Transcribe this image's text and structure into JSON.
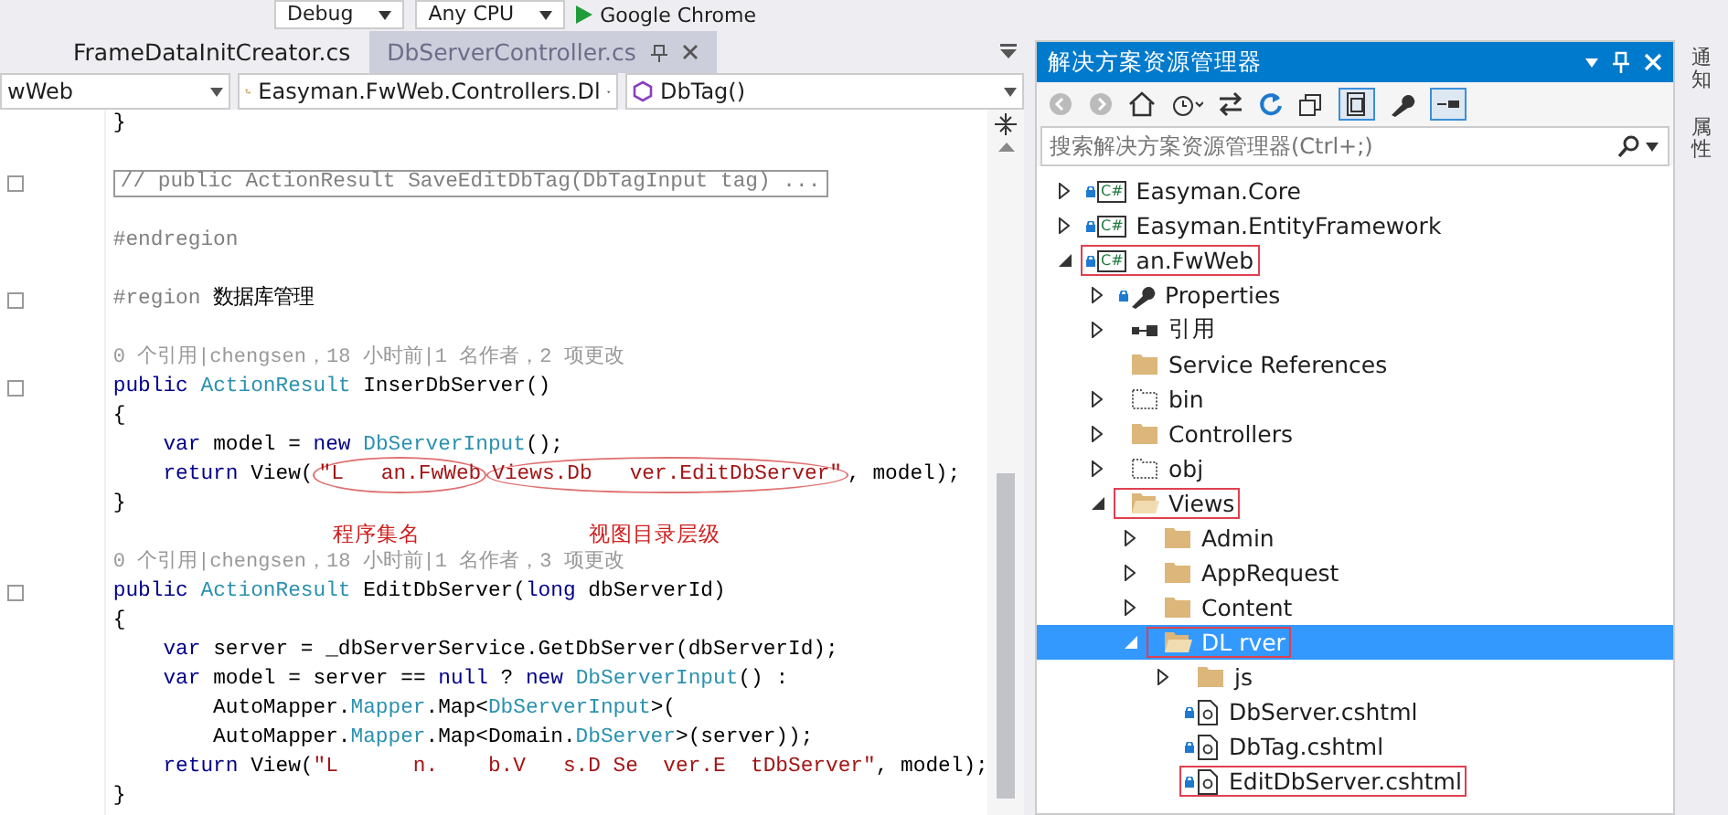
{
  "toolbar": {
    "config": "Debug",
    "platform": "Any CPU",
    "run_target": "Google Chrome"
  },
  "editor": {
    "tabs": [
      {
        "label": "FrameDataInitCreator.cs",
        "selected": false
      },
      {
        "label": "DbServerController.cs",
        "selected": true
      }
    ],
    "nav": {
      "project": "wWeb",
      "type": "Easyman.FwWeb.Controllers.Dl",
      "member": "DbTag()"
    },
    "lines": [
      {
        "kind": "code",
        "fold": false,
        "tokens": [
          {
            "kind": "plain",
            "text": "}"
          }
        ]
      },
      {
        "kind": "blank",
        "fold": false
      },
      {
        "kind": "code",
        "fold": true,
        "tokens": [
          {
            "kind": "collapsed",
            "text": "// public ActionResult SaveEditDbTag(DbTagInput tag) ..."
          }
        ]
      },
      {
        "kind": "blank",
        "fold": false
      },
      {
        "kind": "code",
        "fold": false,
        "tokens": [
          {
            "kind": "preproc",
            "text": "#endregion"
          }
        ]
      },
      {
        "kind": "blank",
        "fold": false
      },
      {
        "kind": "code",
        "fold": true,
        "tokens": [
          {
            "kind": "preproc",
            "text": "#region"
          },
          {
            "kind": "plain",
            "text": " 数据库管理"
          }
        ]
      },
      {
        "kind": "blank",
        "fold": false
      },
      {
        "kind": "lens",
        "fold": false,
        "tokens": [
          {
            "kind": "plain",
            "text": "0 个引用|chengsen，18 小时前|1 名作者，2 项更改"
          }
        ]
      },
      {
        "kind": "code",
        "fold": true,
        "tokens": [
          {
            "kind": "keyword",
            "text": "public "
          },
          {
            "kind": "type",
            "text": "ActionResult"
          },
          {
            "kind": "plain",
            "text": " InserDbServer()"
          }
        ]
      },
      {
        "kind": "code",
        "fold": false,
        "tokens": [
          {
            "kind": "plain",
            "text": "{"
          }
        ]
      },
      {
        "kind": "code",
        "fold": false,
        "tokens": [
          {
            "kind": "keyword",
            "text": "    var"
          },
          {
            "kind": "plain",
            "text": " model = "
          },
          {
            "kind": "keyword",
            "text": "new "
          },
          {
            "kind": "type",
            "text": "DbServerInput"
          },
          {
            "kind": "plain",
            "text": "();"
          }
        ]
      },
      {
        "kind": "code",
        "fold": false,
        "tokens": [
          {
            "kind": "keyword",
            "text": "    return"
          },
          {
            "kind": "plain",
            "text": " View("
          },
          {
            "kind": "string-circled",
            "text": "\"L   an.FwWeb"
          },
          {
            "kind": "string-circled",
            "text": "Views.Db   ver.EditDbServer\""
          },
          {
            "kind": "plain",
            "text": ", model);"
          }
        ]
      },
      {
        "kind": "code",
        "fold": false,
        "tokens": [
          {
            "kind": "plain",
            "text": "}"
          }
        ]
      },
      {
        "kind": "note",
        "fold": false,
        "tokens": [
          {
            "kind": "label",
            "text": "程序集名"
          },
          {
            "kind": "label",
            "text": "视图目录层级"
          }
        ]
      },
      {
        "kind": "lens",
        "fold": false,
        "tokens": [
          {
            "kind": "plain",
            "text": "0 个引用|chengsen，18 小时前|1 名作者，3 项更改"
          }
        ]
      },
      {
        "kind": "code",
        "fold": true,
        "tokens": [
          {
            "kind": "keyword",
            "text": "public "
          },
          {
            "kind": "type",
            "text": "ActionResult"
          },
          {
            "kind": "plain",
            "text": " EditDbServer("
          },
          {
            "kind": "keyword",
            "text": "long"
          },
          {
            "kind": "plain",
            "text": " dbServerId)"
          }
        ]
      },
      {
        "kind": "code",
        "fold": false,
        "tokens": [
          {
            "kind": "plain",
            "text": "{"
          }
        ]
      },
      {
        "kind": "code",
        "fold": false,
        "tokens": [
          {
            "kind": "keyword",
            "text": "    var"
          },
          {
            "kind": "plain",
            "text": " server = _dbServerService.GetDbServer(dbServerId);"
          }
        ]
      },
      {
        "kind": "code",
        "fold": false,
        "tokens": [
          {
            "kind": "keyword",
            "text": "    var"
          },
          {
            "kind": "plain",
            "text": " model = server == "
          },
          {
            "kind": "keyword",
            "text": "null"
          },
          {
            "kind": "plain",
            "text": " ? "
          },
          {
            "kind": "keyword",
            "text": "new "
          },
          {
            "kind": "type",
            "text": "DbServerInput"
          },
          {
            "kind": "plain",
            "text": "() :"
          }
        ]
      },
      {
        "kind": "code",
        "fold": false,
        "tokens": [
          {
            "kind": "plain",
            "text": "        AutoMapper."
          },
          {
            "kind": "type",
            "text": "Mapper"
          },
          {
            "kind": "plain",
            "text": ".Map<"
          },
          {
            "kind": "type",
            "text": "DbServerInput"
          },
          {
            "kind": "plain",
            "text": ">("
          }
        ]
      },
      {
        "kind": "code",
        "fold": false,
        "tokens": [
          {
            "kind": "plain",
            "text": "        AutoMapper."
          },
          {
            "kind": "type",
            "text": "Mapper"
          },
          {
            "kind": "plain",
            "text": ".Map<Domain."
          },
          {
            "kind": "type",
            "text": "DbServer"
          },
          {
            "kind": "plain",
            "text": ">(server));"
          }
        ]
      },
      {
        "kind": "code",
        "fold": false,
        "tokens": [
          {
            "kind": "keyword",
            "text": "    return"
          },
          {
            "kind": "plain",
            "text": " View("
          },
          {
            "kind": "string",
            "text": "\"L      n.    b.V   s.D Se  ver.E  tDbServer\""
          },
          {
            "kind": "plain",
            "text": ", model);"
          }
        ]
      },
      {
        "kind": "code",
        "fold": false,
        "tokens": [
          {
            "kind": "plain",
            "text": "}"
          }
        ]
      }
    ]
  },
  "explorer": {
    "title": "解决方案资源管理器",
    "search": {
      "placeholder": "搜索解决方案资源管理器(Ctrl+;)"
    },
    "tree": [
      {
        "label": "Easyman.Core",
        "kind": "project",
        "badge": "C#",
        "expandable": true,
        "expanded": false,
        "locked": true,
        "selected": false,
        "marked": false
      },
      {
        "label": "Easyman.EntityFramework",
        "kind": "project",
        "badge": "C#",
        "expandable": true,
        "expanded": false,
        "locked": true,
        "selected": false,
        "marked": false
      },
      {
        "label": "an.FwWeb",
        "kind": "project",
        "badge": "C#",
        "expandable": true,
        "expanded": true,
        "locked": true,
        "selected": false,
        "marked": true,
        "children": [
          {
            "label": "Properties",
            "kind": "properties",
            "expandable": true,
            "expanded": false,
            "locked": true,
            "selected": false,
            "marked": false
          },
          {
            "label": "引用",
            "kind": "references",
            "expandable": true,
            "expanded": false,
            "locked": false,
            "selected": false,
            "marked": false
          },
          {
            "label": "Service References",
            "kind": "folder",
            "expandable": false,
            "expanded": false,
            "locked": false,
            "selected": false,
            "marked": false
          },
          {
            "label": "bin",
            "kind": "hidden-folder",
            "expandable": true,
            "expanded": false,
            "locked": false,
            "selected": false,
            "marked": false
          },
          {
            "label": "Controllers",
            "kind": "folder",
            "expandable": true,
            "expanded": false,
            "locked": false,
            "selected": false,
            "marked": false
          },
          {
            "label": "obj",
            "kind": "hidden-folder",
            "expandable": true,
            "expanded": false,
            "locked": false,
            "selected": false,
            "marked": false
          },
          {
            "label": "Views",
            "kind": "folder",
            "expandable": true,
            "expanded": true,
            "locked": false,
            "selected": false,
            "marked": true,
            "children": [
              {
                "label": "Admin",
                "kind": "folder",
                "expandable": true,
                "expanded": false,
                "locked": false,
                "selected": false,
                "marked": false
              },
              {
                "label": "AppRequest",
                "kind": "folder",
                "expandable": true,
                "expanded": false,
                "locked": false,
                "selected": false,
                "marked": false
              },
              {
                "label": "Content",
                "kind": "folder",
                "expandable": true,
                "expanded": false,
                "locked": false,
                "selected": false,
                "marked": false
              },
              {
                "label": "DL rver",
                "kind": "folder",
                "expandable": true,
                "expanded": true,
                "locked": false,
                "selected": true,
                "marked": true,
                "children": [
                  {
                    "label": "js",
                    "kind": "folder",
                    "expandable": true,
                    "expanded": false,
                    "locked": false,
                    "selected": false,
                    "marked": false
                  },
                  {
                    "label": "DbServer.cshtml",
                    "kind": "razor-file",
                    "expandable": false,
                    "expanded": false,
                    "locked": true,
                    "selected": false,
                    "marked": false
                  },
                  {
                    "label": "DbTag.cshtml",
                    "kind": "razor-file",
                    "expandable": false,
                    "expanded": false,
                    "locked": true,
                    "selected": false,
                    "marked": false
                  },
                  {
                    "label": "EditDbServer.cshtml",
                    "kind": "razor-file",
                    "expandable": false,
                    "expanded": false,
                    "locked": true,
                    "selected": false,
                    "marked": true
                  }
                ]
              }
            ]
          }
        ]
      }
    ]
  },
  "side_tabs": [
    {
      "label": "通知"
    },
    {
      "label": "属性"
    }
  ]
}
